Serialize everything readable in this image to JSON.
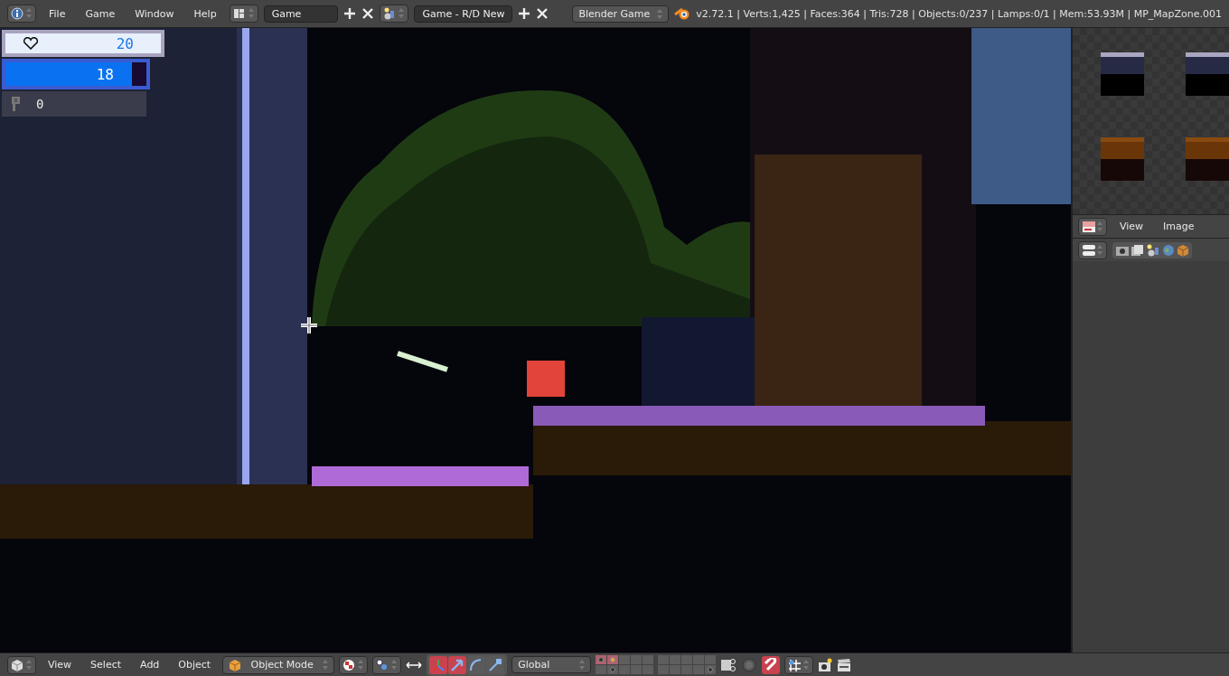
{
  "top_bar": {
    "menus": [
      "File",
      "Game",
      "Window",
      "Help"
    ],
    "screen_layout": "Game",
    "scene": "Game - R/D New",
    "render_engine": "Blender Game",
    "stats": "v2.72.1 | Verts:1,425 | Faces:364 | Tris:728 | Objects:0/237 | Lamps:0/1 | Mem:53.93M | MP_MapZone.001"
  },
  "game_hud": {
    "health": "20",
    "energy": {
      "value": "18",
      "level": 0.9
    },
    "keys": "0"
  },
  "image_editor": {
    "menus": [
      "View",
      "Image"
    ]
  },
  "viewport_header": {
    "menus": [
      "View",
      "Select",
      "Add",
      "Object"
    ],
    "mode": "Object Mode",
    "manipulator_on": true,
    "manipulator_tools": [
      {
        "kind": "translate",
        "selected": true
      },
      {
        "kind": "rotate",
        "selected": false
      },
      {
        "kind": "scale",
        "selected": false
      }
    ],
    "orientation": "Global",
    "layers": [
      {
        "used": true,
        "selected": true,
        "active": false
      },
      {
        "used": true,
        "selected": true,
        "active": true
      },
      {
        "used": false,
        "selected": false,
        "active": false
      },
      {
        "used": false,
        "selected": false,
        "active": false
      },
      {
        "used": false,
        "selected": false,
        "active": false
      },
      {
        "used": false,
        "selected": false,
        "active": false
      },
      {
        "used": false,
        "selected": false,
        "active": false
      },
      {
        "used": false,
        "selected": false,
        "active": false
      },
      {
        "used": false,
        "selected": false,
        "active": false
      },
      {
        "used": false,
        "selected": false,
        "active": false
      },
      {
        "used": false,
        "selected": false,
        "active": false
      },
      {
        "used": true,
        "selected": false,
        "active": false
      },
      {
        "used": false,
        "selected": false
      },
      {
        "used": false,
        "selected": false
      },
      {
        "used": false,
        "selected": false
      },
      {
        "used": false,
        "selected": false
      },
      {
        "used": false,
        "selected": false
      },
      {
        "used": false,
        "selected": false
      },
      {
        "used": false,
        "selected": false
      },
      {
        "used": true,
        "selected": false
      }
    ],
    "snap_on": true
  }
}
